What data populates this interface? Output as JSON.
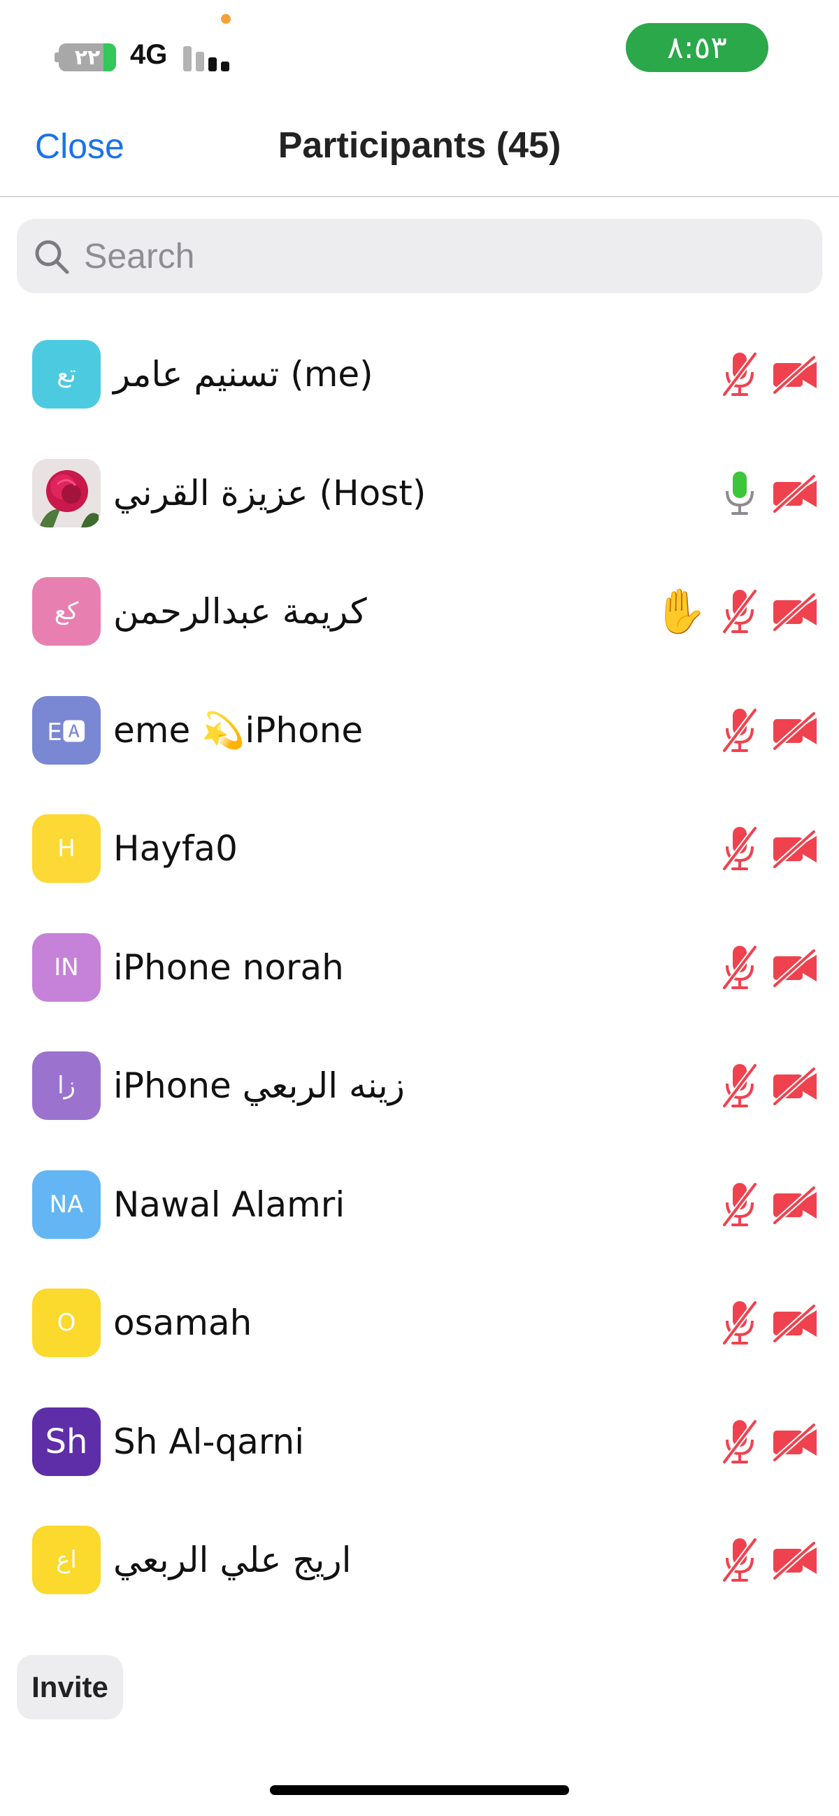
{
  "status_bar": {
    "battery_level": "٢٢",
    "battery_fraction": 0.22,
    "network": "4G",
    "time": "٨:٥٣"
  },
  "header": {
    "close_label": "Close",
    "title": "Participants (45)"
  },
  "search": {
    "placeholder": "Search"
  },
  "participants": [
    {
      "initials": "تع",
      "avatar_color": "#4ccbe0",
      "name": "تسنيم عامر (me)",
      "mic": "muted",
      "video": "off"
    },
    {
      "initials": "",
      "avatar_type": "photo-rose",
      "name": "عزيزة القرني (Host)",
      "mic": "on",
      "video": "off"
    },
    {
      "initials": "كع",
      "avatar_color": "#e780b1",
      "name": "كريمة عبدالرحمن",
      "hand_raised": true,
      "mic": "muted",
      "video": "off"
    },
    {
      "initials": "E🅰",
      "avatar_color": "#7a87d2",
      "name": "eme 💫iPhone",
      "mic": "muted",
      "video": "off"
    },
    {
      "initials": "H",
      "avatar_color": "#fcd934",
      "name": "Hayfa0",
      "mic": "muted",
      "video": "off"
    },
    {
      "initials": "IN",
      "avatar_color": "#c582d8",
      "name": "iPhone norah",
      "mic": "muted",
      "video": "off"
    },
    {
      "initials": "زا",
      "avatar_color": "#9b73cf",
      "name": "iPhone زينه الربعي",
      "mic": "muted",
      "video": "off"
    },
    {
      "initials": "NA",
      "avatar_color": "#63b6f3",
      "name": "Nawal Alamri",
      "mic": "muted",
      "video": "off"
    },
    {
      "initials": "O",
      "avatar_color": "#fbd92d",
      "name": "osamah",
      "mic": "muted",
      "video": "off"
    },
    {
      "initials": "Sh",
      "avatar_color": "#5e2ea8",
      "name": "Sh Al-qarni",
      "mic": "muted",
      "video": "off"
    },
    {
      "initials": "اع",
      "avatar_color": "#fbd92d",
      "name": "اريج  علي الربعي",
      "mic": "muted",
      "video": "off"
    }
  ],
  "invite_label": "Invite",
  "colors": {
    "accent": "#1a73e8",
    "muted_red": "#f0424e",
    "mic_active_green": "#3ec63a",
    "clock_green": "#2aa84a"
  }
}
